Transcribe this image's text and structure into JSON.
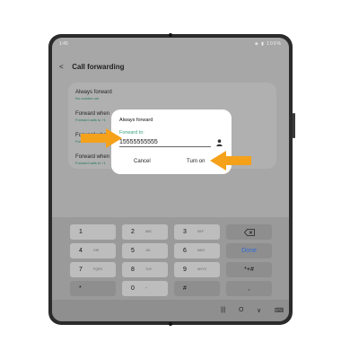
{
  "status_bar": {
    "time": "1:45",
    "icons": "◈ ▮ 100%"
  },
  "header": {
    "title": "Call forwarding"
  },
  "settings": [
    {
      "title": "Always forward",
      "subtitle": "No number set"
    },
    {
      "title": "Forward when",
      "subtitle": "Forward calls to +1"
    },
    {
      "title": "Forward when",
      "subtitle": "For"
    },
    {
      "title": "Forward when",
      "subtitle": "Forward calls to +1"
    }
  ],
  "dialog": {
    "title": "Always forward",
    "field_label": "Forward to:",
    "value": "15555555555",
    "contact_icon": "person-icon",
    "cancel": "Cancel",
    "confirm": "Turn on"
  },
  "keypad": {
    "rows": [
      [
        {
          "key": "1",
          "sub": ""
        },
        {
          "key": "2",
          "sub": "ABC"
        },
        {
          "key": "3",
          "sub": "DEF"
        }
      ],
      [
        {
          "key": "4",
          "sub": "GHI"
        },
        {
          "key": "5",
          "sub": "JKL"
        },
        {
          "key": "6",
          "sub": "MNO"
        }
      ],
      [
        {
          "key": "7",
          "sub": "PQRS"
        },
        {
          "key": "8",
          "sub": "TUV"
        },
        {
          "key": "9",
          "sub": "WXYZ"
        }
      ],
      [
        {
          "key": "*",
          "sub": ""
        },
        {
          "key": "0",
          "sub": "+"
        },
        {
          "key": "#",
          "sub": ""
        }
      ]
    ],
    "backspace_icon": "backspace-icon",
    "done": "Done",
    "pause": "*+#",
    "comma": ","
  },
  "navbar": {
    "recents": "|||",
    "home": "O",
    "back": "∨",
    "keyboard": "⌨"
  },
  "annotations": {
    "arrow_color": "#f5a11a"
  }
}
